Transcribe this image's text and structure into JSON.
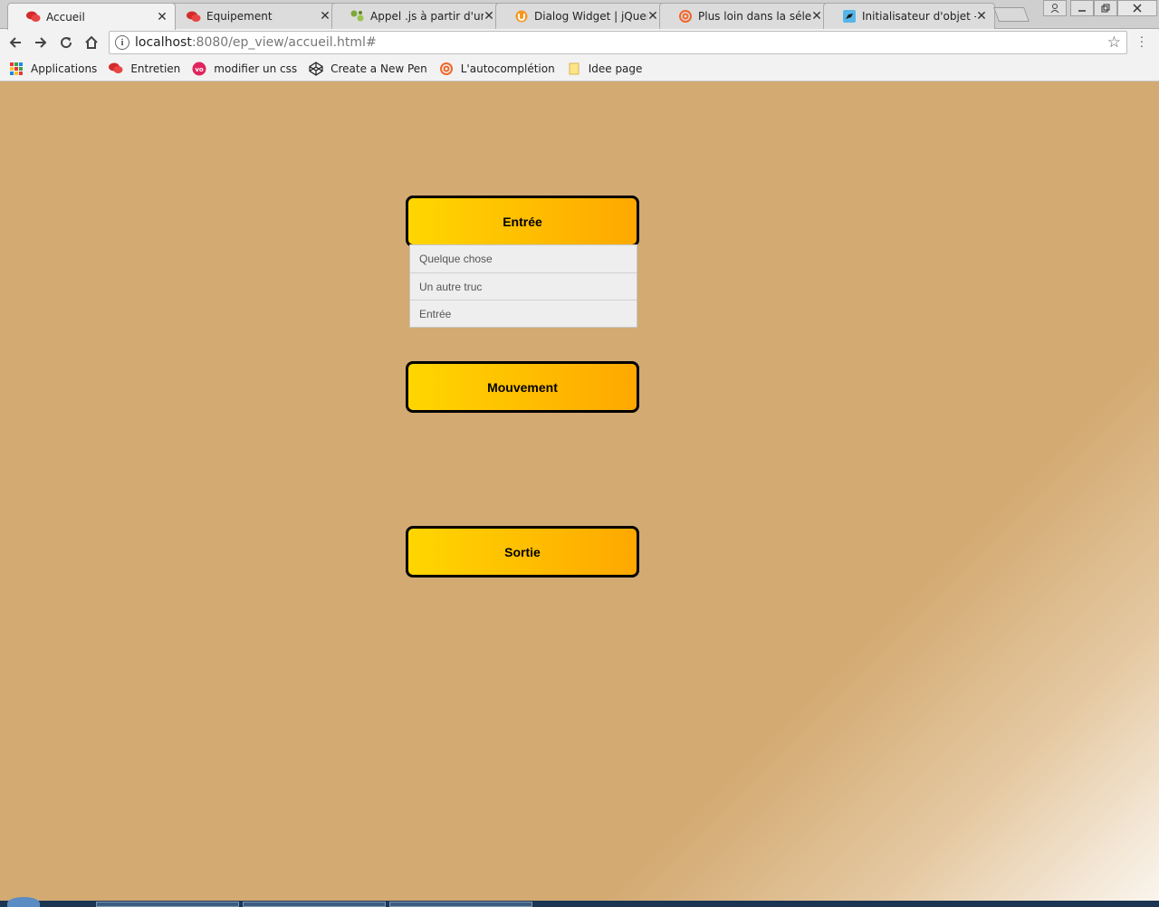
{
  "tabs": [
    {
      "title": "Accueil",
      "icon": "speech-bubbles-icon",
      "active": true
    },
    {
      "title": "Equipement",
      "icon": "speech-bubbles-icon",
      "active": false
    },
    {
      "title": "Appel .js à partir d'un j",
      "icon": "puzzle-icon",
      "active": false
    },
    {
      "title": "Dialog Widget | jQuery",
      "icon": "jquery-ui-icon",
      "active": false
    },
    {
      "title": "Plus loin dans la sélect",
      "icon": "spiral-icon",
      "active": false
    },
    {
      "title": "Initialisateur d'objet - J",
      "icon": "dino-icon",
      "active": false
    }
  ],
  "address": {
    "host": "localhost",
    "path": ":8080/ep_view/accueil.html#"
  },
  "bookmarks": [
    {
      "label": "Applications",
      "icon": "apps-grid-icon"
    },
    {
      "label": "Entretien",
      "icon": "speech-bubbles-icon"
    },
    {
      "label": "modifier un css",
      "icon": "vo-icon"
    },
    {
      "label": "Create a New Pen",
      "icon": "codepen-icon"
    },
    {
      "label": "L'autocomplétion",
      "icon": "spiral-icon"
    },
    {
      "label": "Idee page",
      "icon": "folder-icon"
    }
  ],
  "main": {
    "entree": {
      "label": "Entrée"
    },
    "mouvement": {
      "label": "Mouvement"
    },
    "sortie": {
      "label": "Sortie"
    },
    "dropdown": [
      "Quelque chose",
      "Un autre truc",
      "Entrée"
    ]
  },
  "colors": {
    "page_bg": "#d3aa72",
    "button_start": "#ffd600",
    "button_end": "#ffa800",
    "button_border": "#000000"
  }
}
